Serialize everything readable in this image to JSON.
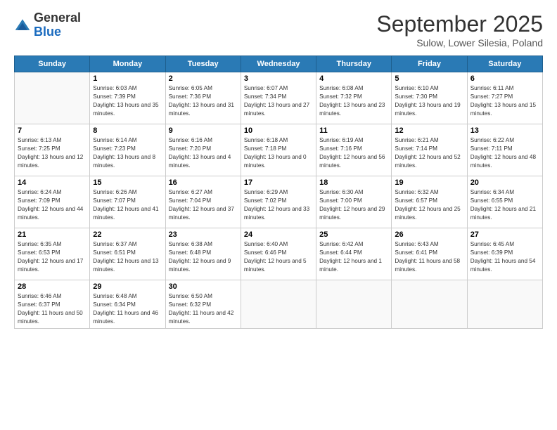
{
  "logo": {
    "general": "General",
    "blue": "Blue"
  },
  "header": {
    "month": "September 2025",
    "location": "Sulow, Lower Silesia, Poland"
  },
  "weekdays": [
    "Sunday",
    "Monday",
    "Tuesday",
    "Wednesday",
    "Thursday",
    "Friday",
    "Saturday"
  ],
  "weeks": [
    [
      null,
      {
        "day": "1",
        "sunrise": "6:03 AM",
        "sunset": "7:39 PM",
        "daylight": "13 hours and 35 minutes."
      },
      {
        "day": "2",
        "sunrise": "6:05 AM",
        "sunset": "7:36 PM",
        "daylight": "13 hours and 31 minutes."
      },
      {
        "day": "3",
        "sunrise": "6:07 AM",
        "sunset": "7:34 PM",
        "daylight": "13 hours and 27 minutes."
      },
      {
        "day": "4",
        "sunrise": "6:08 AM",
        "sunset": "7:32 PM",
        "daylight": "13 hours and 23 minutes."
      },
      {
        "day": "5",
        "sunrise": "6:10 AM",
        "sunset": "7:30 PM",
        "daylight": "13 hours and 19 minutes."
      },
      {
        "day": "6",
        "sunrise": "6:11 AM",
        "sunset": "7:27 PM",
        "daylight": "13 hours and 15 minutes."
      }
    ],
    [
      {
        "day": "7",
        "sunrise": "6:13 AM",
        "sunset": "7:25 PM",
        "daylight": "13 hours and 12 minutes."
      },
      {
        "day": "8",
        "sunrise": "6:14 AM",
        "sunset": "7:23 PM",
        "daylight": "13 hours and 8 minutes."
      },
      {
        "day": "9",
        "sunrise": "6:16 AM",
        "sunset": "7:20 PM",
        "daylight": "13 hours and 4 minutes."
      },
      {
        "day": "10",
        "sunrise": "6:18 AM",
        "sunset": "7:18 PM",
        "daylight": "13 hours and 0 minutes."
      },
      {
        "day": "11",
        "sunrise": "6:19 AM",
        "sunset": "7:16 PM",
        "daylight": "12 hours and 56 minutes."
      },
      {
        "day": "12",
        "sunrise": "6:21 AM",
        "sunset": "7:14 PM",
        "daylight": "12 hours and 52 minutes."
      },
      {
        "day": "13",
        "sunrise": "6:22 AM",
        "sunset": "7:11 PM",
        "daylight": "12 hours and 48 minutes."
      }
    ],
    [
      {
        "day": "14",
        "sunrise": "6:24 AM",
        "sunset": "7:09 PM",
        "daylight": "12 hours and 44 minutes."
      },
      {
        "day": "15",
        "sunrise": "6:26 AM",
        "sunset": "7:07 PM",
        "daylight": "12 hours and 41 minutes."
      },
      {
        "day": "16",
        "sunrise": "6:27 AM",
        "sunset": "7:04 PM",
        "daylight": "12 hours and 37 minutes."
      },
      {
        "day": "17",
        "sunrise": "6:29 AM",
        "sunset": "7:02 PM",
        "daylight": "12 hours and 33 minutes."
      },
      {
        "day": "18",
        "sunrise": "6:30 AM",
        "sunset": "7:00 PM",
        "daylight": "12 hours and 29 minutes."
      },
      {
        "day": "19",
        "sunrise": "6:32 AM",
        "sunset": "6:57 PM",
        "daylight": "12 hours and 25 minutes."
      },
      {
        "day": "20",
        "sunrise": "6:34 AM",
        "sunset": "6:55 PM",
        "daylight": "12 hours and 21 minutes."
      }
    ],
    [
      {
        "day": "21",
        "sunrise": "6:35 AM",
        "sunset": "6:53 PM",
        "daylight": "12 hours and 17 minutes."
      },
      {
        "day": "22",
        "sunrise": "6:37 AM",
        "sunset": "6:51 PM",
        "daylight": "12 hours and 13 minutes."
      },
      {
        "day": "23",
        "sunrise": "6:38 AM",
        "sunset": "6:48 PM",
        "daylight": "12 hours and 9 minutes."
      },
      {
        "day": "24",
        "sunrise": "6:40 AM",
        "sunset": "6:46 PM",
        "daylight": "12 hours and 5 minutes."
      },
      {
        "day": "25",
        "sunrise": "6:42 AM",
        "sunset": "6:44 PM",
        "daylight": "12 hours and 1 minute."
      },
      {
        "day": "26",
        "sunrise": "6:43 AM",
        "sunset": "6:41 PM",
        "daylight": "11 hours and 58 minutes."
      },
      {
        "day": "27",
        "sunrise": "6:45 AM",
        "sunset": "6:39 PM",
        "daylight": "11 hours and 54 minutes."
      }
    ],
    [
      {
        "day": "28",
        "sunrise": "6:46 AM",
        "sunset": "6:37 PM",
        "daylight": "11 hours and 50 minutes."
      },
      {
        "day": "29",
        "sunrise": "6:48 AM",
        "sunset": "6:34 PM",
        "daylight": "11 hours and 46 minutes."
      },
      {
        "day": "30",
        "sunrise": "6:50 AM",
        "sunset": "6:32 PM",
        "daylight": "11 hours and 42 minutes."
      },
      null,
      null,
      null,
      null
    ]
  ],
  "labels": {
    "sunrise": "Sunrise:",
    "sunset": "Sunset:",
    "daylight": "Daylight:"
  }
}
